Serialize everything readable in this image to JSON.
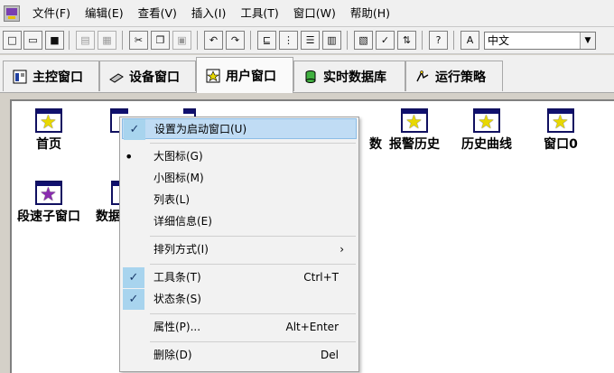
{
  "menubar": {
    "items": [
      "文件(F)",
      "编辑(E)",
      "查看(V)",
      "插入(I)",
      "工具(T)",
      "窗口(W)",
      "帮助(H)"
    ]
  },
  "toolbar": {
    "language_value": "中文",
    "buttons": [
      "new-file-icon",
      "open-folder-icon",
      "save-icon",
      "print-icon",
      "print-preview-icon",
      "cut-icon",
      "copy-icon",
      "paste-icon",
      "undo-icon",
      "redo-icon",
      "align-left-icon",
      "tree-icon",
      "list-icon",
      "grid-icon",
      "properties-icon",
      "check-icon",
      "sort-icon",
      "help-icon",
      "language-icon"
    ]
  },
  "tabs": [
    {
      "label": "主控窗口",
      "icon": "main-window-icon"
    },
    {
      "label": "设备窗口",
      "icon": "device-icon"
    },
    {
      "label": "用户窗口",
      "icon": "user-window-icon"
    },
    {
      "label": "实时数据库",
      "icon": "database-icon"
    },
    {
      "label": "运行策略",
      "icon": "strategy-icon"
    }
  ],
  "content": {
    "items": [
      {
        "label": "首页"
      },
      {
        "label": "数"
      },
      {
        "label": "报警历史"
      },
      {
        "label": "历史曲线"
      },
      {
        "label": "窗口0"
      },
      {
        "label": "段速子窗口"
      },
      {
        "label": "数据"
      }
    ]
  },
  "context_menu": {
    "set_startup": "设置为启动窗口(U)",
    "large_icons": "大图标(G)",
    "small_icons": "小图标(M)",
    "list": "列表(L)",
    "details": "详细信息(E)",
    "arrange": "排列方式(I)",
    "toolbar": "工具条(T)",
    "toolbar_shortcut": "Ctrl+T",
    "statusbar": "状态条(S)",
    "properties": "属性(P)...",
    "properties_shortcut": "Alt+Enter",
    "delete": "删除(D)",
    "delete_shortcut": "Del"
  },
  "colors": {
    "highlight": "#c0dcf4",
    "check_bg": "#a8d4ee",
    "star_yellow": "#e8d800",
    "star_purple": "#8a2bb0"
  }
}
